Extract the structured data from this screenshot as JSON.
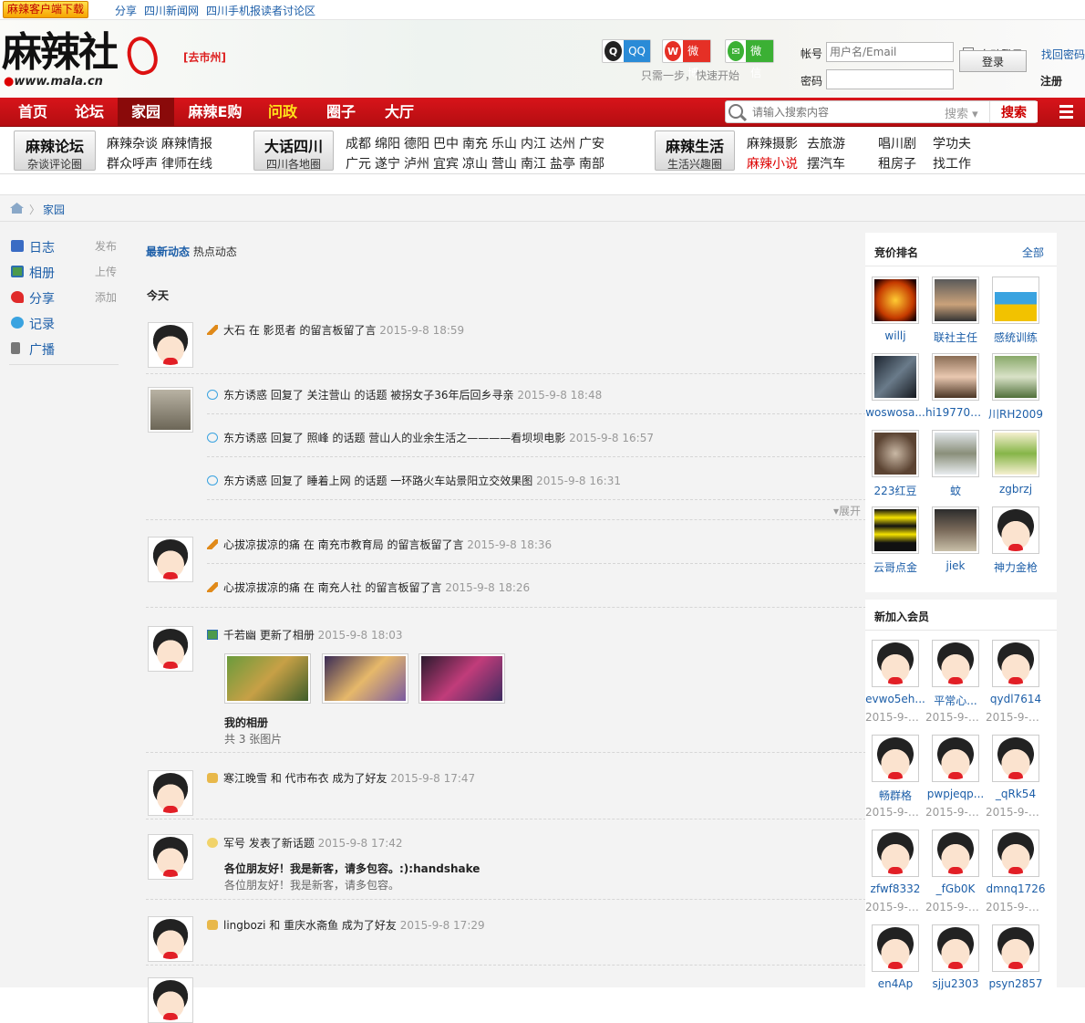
{
  "topbar": {
    "download_label": "麻辣客户端下载",
    "links": [
      "分享",
      "四川新闻网",
      "四川手机报读者讨论区"
    ]
  },
  "header": {
    "logo_text": "麻辣社",
    "logo_url_text": "www.mala.cn",
    "city": "[去市州]",
    "social": [
      {
        "label": "QQ",
        "icon": "qq-icon",
        "color": "#2a8bd7"
      },
      {
        "label": "微博",
        "icon": "weibo-icon",
        "color": "#e53026"
      },
      {
        "label": "微信",
        "icon": "wechat-icon",
        "color": "#3bb034"
      }
    ],
    "quick_tip": "只需一步，快速开始"
  },
  "login": {
    "account_label": "帐号",
    "account_placeholder": "用户名/Email",
    "password_label": "密码",
    "auto_login_label": "自动登录",
    "forgot_label": "找回密码",
    "login_button": "登录",
    "register_label": "注册"
  },
  "nav": {
    "items": [
      "首页",
      "论坛",
      "家园",
      "麻辣E购",
      "问政",
      "圈子",
      "大厅"
    ],
    "active": "家园",
    "search_placeholder": "请输入搜索内容",
    "search_type": "搜索",
    "search_button": "搜索"
  },
  "categories": [
    {
      "title": "麻辣论坛",
      "subtitle": "杂谈评论圈",
      "links": [
        "麻辣杂谈",
        "麻辣情报",
        "群众呼声",
        "律师在线"
      ]
    },
    {
      "title": "大话四川",
      "subtitle": "四川各地圈",
      "links": [
        "成都",
        "绵阳",
        "德阳",
        "巴中",
        "南充",
        "乐山",
        "内江",
        "达州",
        "广安",
        "广元",
        "遂宁",
        "泸州",
        "宜宾",
        "凉山",
        "营山",
        "南江",
        "盐亭",
        "南部"
      ]
    },
    {
      "title": "麻辣生活",
      "subtitle": "生活兴趣圈",
      "links": [
        "麻辣摄影",
        "去旅游",
        "唱川剧",
        "学功夫",
        "麻辣小说",
        "摆汽车",
        "租房子",
        "找工作"
      ]
    }
  ],
  "breadcrumb": {
    "current": "家园"
  },
  "sidebar": {
    "items": [
      {
        "label": "日志",
        "action": "发布",
        "icon": "blog-icon",
        "color": "#3a6cc4"
      },
      {
        "label": "相册",
        "action": "上传",
        "icon": "album-icon",
        "color": "#4c9a4c"
      },
      {
        "label": "分享",
        "action": "添加",
        "icon": "share-icon",
        "color": "#e02a2a"
      },
      {
        "label": "记录",
        "action": "",
        "icon": "record-icon",
        "color": "#3aa3e0"
      },
      {
        "label": "广播",
        "action": "",
        "icon": "broadcast-icon",
        "color": "#777777"
      }
    ]
  },
  "feed": {
    "tabs": [
      "最新动态",
      "热点动态"
    ],
    "today_label": "今天",
    "expand_label": "展开",
    "entries": [
      {
        "text": "大石 在 影觅者 的留言板留了言",
        "time": "2015-9-8 18:59"
      },
      {
        "text": "东方诱惑 回复了 关注营山 的话题 被拐女子36年后回乡寻亲",
        "time": "2015-9-8 18:48"
      },
      {
        "text": "东方诱惑 回复了 照峰 的话题 营山人的业余生活之————看坝坝电影",
        "time": "2015-9-8 16:57"
      },
      {
        "text": "东方诱惑 回复了 睡着上网 的话题 一环路火车站景阳立交效果图",
        "time": "2015-9-8 16:31"
      },
      {
        "text": "心拔凉拔凉的痛 在 南充市教育局 的留言板留了言",
        "time": "2015-9-8 18:36"
      },
      {
        "text": "心拔凉拔凉的痛 在 南充人社 的留言板留了言",
        "time": "2015-9-8 18:26"
      },
      {
        "text": "千若幽 更新了相册",
        "time": "2015-9-8 18:03"
      },
      {
        "text": "寒江晚雪 和 代市布衣 成为了好友",
        "time": "2015-9-8 17:47"
      },
      {
        "text": "军号 发表了新话题",
        "time": "2015-9-8 17:42"
      },
      {
        "text": "lingbozi 和 重庆水斋鱼 成为了好友",
        "time": "2015-9-8 17:29"
      }
    ],
    "album": {
      "title": "我的相册",
      "subtitle": "共 3 张图片"
    },
    "topic": {
      "title": "各位朋友好！我是新客，请多包容。:):handshake",
      "body": "各位朋友好！我是新客，请多包容。"
    }
  },
  "right": {
    "ranking_title": "竞价排名",
    "ranking_more": "全部",
    "ranking": [
      "willj",
      "联社主任",
      "感统训练",
      "woswosa...",
      "hi19770726",
      "川RH2009",
      "223红豆",
      "蚊",
      "zgbrzj",
      "云哥点金",
      "jiek",
      "神力金枪"
    ],
    "new_title": "新加入会员",
    "new_members": [
      {
        "name": "evwo5eh...",
        "date": "2015-9-8 ..."
      },
      {
        "name": "平常心...",
        "date": "2015-9-8 ..."
      },
      {
        "name": "qydl7614",
        "date": "2015-9-8 ..."
      },
      {
        "name": "畅群格",
        "date": "2015-9-8 ..."
      },
      {
        "name": "pwpjeqp...",
        "date": "2015-9-8 ..."
      },
      {
        "name": "_qRk54",
        "date": "2015-9-8 ..."
      },
      {
        "name": "zfwf8332",
        "date": "2015-9-8 ..."
      },
      {
        "name": "_fGb0K",
        "date": "2015-9-8 ..."
      },
      {
        "name": "dmnq1726",
        "date": "2015-9-8 ..."
      },
      {
        "name": "en4Ap",
        "date": ""
      },
      {
        "name": "sjju2303",
        "date": ""
      },
      {
        "name": "psyn2857",
        "date": ""
      }
    ]
  }
}
